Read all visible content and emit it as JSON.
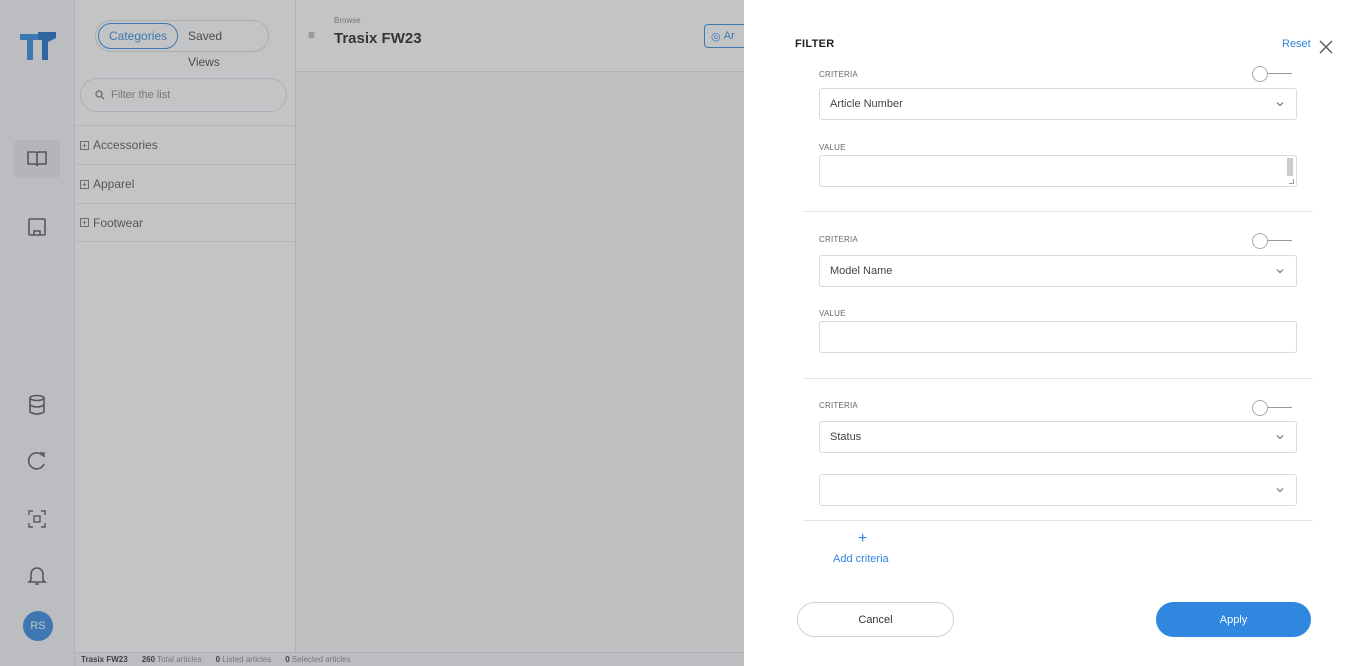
{
  "sidebar": {
    "user_initials": "RS",
    "icons": [
      "logo-icon",
      "book-icon",
      "tray-icon",
      "database-icon",
      "refresh-icon",
      "scan-icon",
      "bell-icon"
    ]
  },
  "category_panel": {
    "tabs": [
      {
        "label": "Categories",
        "active": true
      },
      {
        "label": "Saved Views",
        "active": false
      }
    ],
    "search_placeholder": "Filter the list",
    "categories": [
      "Accessories",
      "Apparel",
      "Footwear"
    ]
  },
  "header": {
    "breadcrumb": "Browse",
    "title": "Trasix FW23",
    "action_button_partial": "Ar"
  },
  "status_bar": {
    "name": "Trasix FW23",
    "total_count": "260",
    "total_label": "Total articles",
    "listed_count": "0",
    "listed_label": "Listed articles",
    "selected_count": "0",
    "selected_label": "Selected articles"
  },
  "filter": {
    "title": "FILTER",
    "reset_label": "Reset",
    "criteria": [
      {
        "label": "CRITERIA",
        "field": "Article Number",
        "value_label": "VALUE",
        "value": ""
      },
      {
        "label": "CRITERIA",
        "field": "Model Name",
        "value_label": "VALUE",
        "value": ""
      },
      {
        "label": "CRITERIA",
        "field": "Status",
        "value_label": "",
        "value": ""
      }
    ],
    "add_criteria_label": "Add criteria",
    "cancel_label": "Cancel",
    "apply_label": "Apply"
  },
  "colors": {
    "accent": "#2f87e0",
    "overlay": "rgba(90,92,96,0.36)"
  }
}
